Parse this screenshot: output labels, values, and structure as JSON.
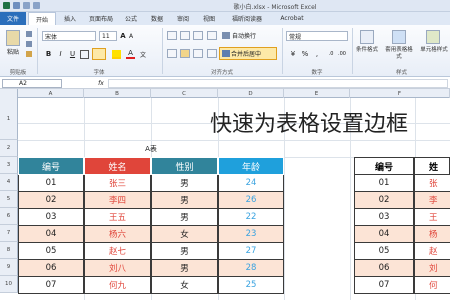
{
  "window": {
    "title": "新建文件夹\\歌小白.xlsx - Microsoft Excel",
    "title_display": "歌小白.xlsx - Microsoft Excel"
  },
  "ribbon": {
    "tabs": [
      "文件",
      "开始",
      "插入",
      "页面布局",
      "公式",
      "数据",
      "审阅",
      "视图",
      "福昕阅读器",
      "Acrobat"
    ],
    "active_tab": "开始",
    "clipboard": {
      "paste_label": "粘贴",
      "group_label": "剪贴板"
    },
    "font": {
      "name": "宋体",
      "size": "11",
      "group_label": "字体",
      "bold": "B",
      "italic": "I",
      "underline": "U"
    },
    "alignment": {
      "wrap_label": "自动换行",
      "merge_label": "合并后居中",
      "group_label": "对齐方式"
    },
    "number": {
      "format": "常规",
      "group_label": "数字"
    },
    "styles": {
      "conditional_label": "条件格式",
      "table_label": "套用表格格式",
      "cell_styles_label": "单元格样式",
      "group_label": "样式"
    }
  },
  "formula_bar": {
    "name_box": "A2",
    "fx": "fx",
    "content": ""
  },
  "columns": [
    "A",
    "B",
    "C",
    "D",
    "E",
    "F"
  ],
  "rows": [
    "1",
    "2",
    "3",
    "4",
    "5",
    "6",
    "7",
    "8",
    "9",
    "10"
  ],
  "sheet": {
    "title": "快速为表格设置边框",
    "table_caption": "A表",
    "headers": [
      "编号",
      "姓名",
      "性别",
      "年龄"
    ],
    "records": [
      [
        "01",
        "张三",
        "男",
        "24"
      ],
      [
        "02",
        "李四",
        "男",
        "26"
      ],
      [
        "03",
        "王五",
        "男",
        "22"
      ],
      [
        "04",
        "杨六",
        "女",
        "23"
      ],
      [
        "05",
        "赵七",
        "男",
        "27"
      ],
      [
        "06",
        "刘八",
        "男",
        "28"
      ],
      [
        "07",
        "何九",
        "女",
        "25"
      ]
    ],
    "second_table_headers": [
      "编号",
      "姓"
    ],
    "second_table_names": [
      "张",
      "李",
      "王",
      "杨",
      "赵",
      "刘",
      "何"
    ]
  },
  "colors": {
    "header_num": "#31849b",
    "header_name": "#e0453a",
    "header_gender": "#31849b",
    "header_age": "#1fa0dc",
    "row_stripe": "#fce4d6",
    "name_text": "#e0453a",
    "age_text": "#3aa3e0"
  },
  "icons": [
    "save-icon",
    "undo-icon",
    "redo-icon",
    "paste-icon",
    "cut-icon",
    "copy-icon",
    "format-painter-icon",
    "bold-icon",
    "italic-icon",
    "underline-icon",
    "border-icon",
    "fill-color-icon",
    "font-color-icon",
    "align-icon",
    "wrap-text-icon",
    "merge-center-icon",
    "percent-icon",
    "conditional-format-icon",
    "table-format-icon",
    "cell-styles-icon",
    "fx-icon"
  ]
}
